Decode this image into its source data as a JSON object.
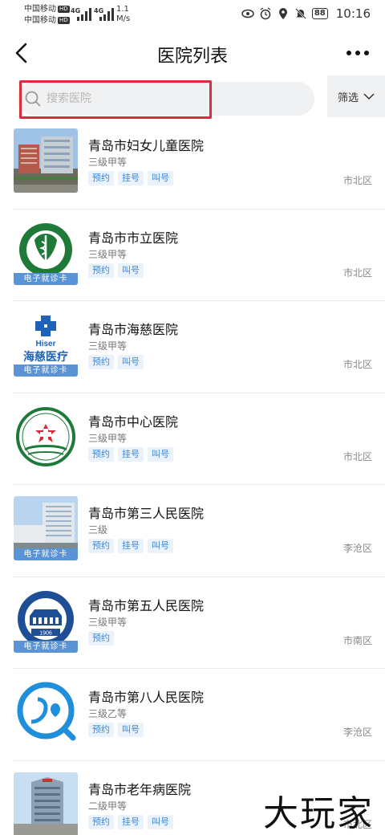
{
  "status_bar": {
    "carrier1": "中国移动",
    "carrier2": "中国移动",
    "hd": "HD",
    "net1": "4G",
    "net2": "4G",
    "speed_value": "1.1",
    "speed_unit": "M/s",
    "battery": "88",
    "time": "10:16"
  },
  "navbar": {
    "title": "医院列表"
  },
  "search": {
    "placeholder": "搜索医院",
    "value": ""
  },
  "filter": {
    "label": "筛选"
  },
  "hospitals": [
    {
      "name": "青岛市妇女儿童医院",
      "level": "三级甲等",
      "tags": [
        "预约",
        "挂号",
        "叫号"
      ],
      "district": "市北区",
      "card": ""
    },
    {
      "name": "青岛市市立医院",
      "level": "三级甲等",
      "tags": [
        "预约",
        "叫号"
      ],
      "district": "市北区",
      "card": "电子就诊卡"
    },
    {
      "name": "青岛市海慈医院",
      "level": "三级甲等",
      "tags": [
        "预约",
        "叫号"
      ],
      "district": "市北区",
      "card": "电子就诊卡",
      "logo_text_1": "Hiser",
      "logo_text_2": "海慈医疗"
    },
    {
      "name": "青岛市中心医院",
      "level": "三级甲等",
      "tags": [
        "预约",
        "挂号",
        "叫号"
      ],
      "district": "市北区",
      "card": ""
    },
    {
      "name": "青岛市第三人民医院",
      "level": "三级",
      "tags": [
        "预约",
        "挂号",
        "叫号"
      ],
      "district": "李沧区",
      "card": "电子就诊卡"
    },
    {
      "name": "青岛市第五人民医院",
      "level": "三级甲等",
      "tags": [
        "预约"
      ],
      "district": "市南区",
      "card": "电子就诊卡",
      "logo_year": "1906"
    },
    {
      "name": "青岛市第八人民医院",
      "level": "三级乙等",
      "tags": [
        "预约",
        "叫号"
      ],
      "district": "李沧区",
      "card": ""
    },
    {
      "name": "青岛市老年病医院",
      "level": "二级甲等",
      "tags": [
        "预约",
        "挂号",
        "叫号"
      ],
      "district": "市北区",
      "card": ""
    }
  ],
  "watermark": "大玩家",
  "colors": {
    "tag_text": "#3d87d8",
    "tag_bg": "#eaf2fc",
    "highlight": "#e02a3a",
    "card_badge": "#5b94d6"
  }
}
